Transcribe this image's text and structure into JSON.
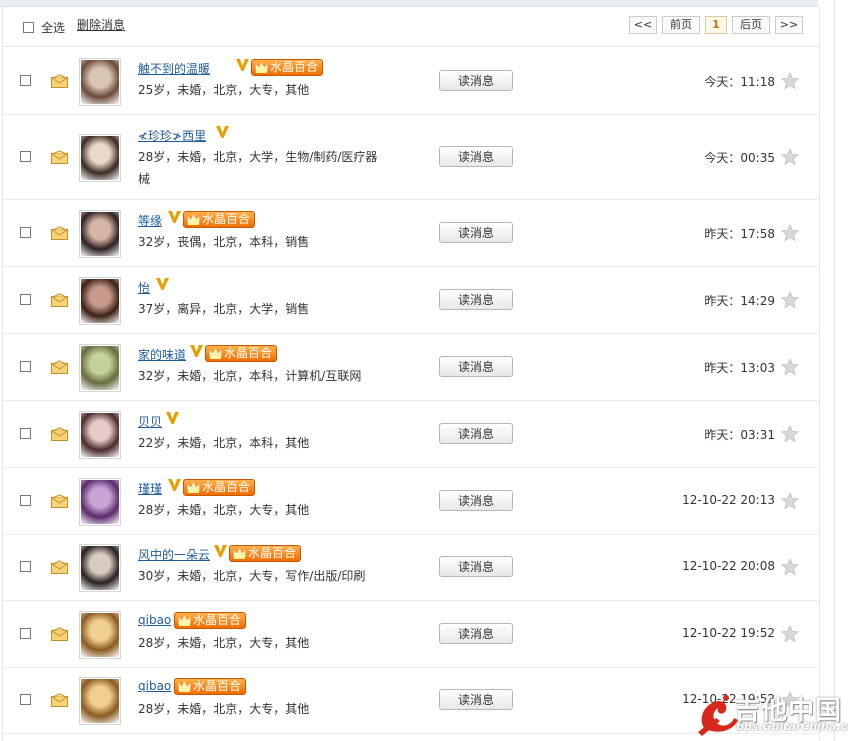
{
  "toolbar": {
    "select_all": "全选",
    "delete": "删除消息"
  },
  "pager": {
    "first": "<<",
    "prev": "前页",
    "current": "1",
    "next": "后页",
    "last": ">>"
  },
  "read_label": "读消息",
  "badge_text": "水晶百合",
  "colors": {
    "link": "#1f5c99",
    "badge_bg": "#ef6d00",
    "vip": "#e8a000",
    "current_page": "#d56a00"
  },
  "icons": {
    "envelope": "envelope-icon",
    "star": "star-icon",
    "vip": "vip-v-icon",
    "crown": "crown-icon"
  },
  "messages": [
    {
      "name": "触不到的温暖",
      "vip": true,
      "badge": true,
      "info": "25岁，未婚，北京，大专，其他",
      "time": "今天：11:18"
    },
    {
      "name": "≮珍珍≯西里",
      "vip": true,
      "badge": false,
      "info": "28岁，未婚，北京，大学，生物/制药/医疗器械",
      "time": "今天：00:35"
    },
    {
      "name": "等缘",
      "vip": true,
      "badge": true,
      "info": "32岁，丧偶，北京，本科，销售",
      "time": "昨天：17:58"
    },
    {
      "name": "怡",
      "vip": true,
      "badge": false,
      "info": "37岁，离异，北京，大学，销售",
      "time": "昨天：14:29"
    },
    {
      "name": "家的味道",
      "vip": true,
      "badge": true,
      "info": "32岁，未婚，北京，本科，计算机/互联网",
      "time": "昨天：13:03"
    },
    {
      "name": "贝贝",
      "vip": true,
      "badge": false,
      "info": "22岁，未婚，北京，本科，其他",
      "time": "昨天：03:31"
    },
    {
      "name": "瑾瑾",
      "vip": true,
      "badge": true,
      "info": "28岁，未婚，北京，大专，其他",
      "time": "12-10-22 20:13"
    },
    {
      "name": "风中的一朵云",
      "vip": true,
      "badge": true,
      "info": "30岁，未婚，北京，大专，写作/出版/印刷",
      "time": "12-10-22 20:08"
    },
    {
      "name": "qibao",
      "vip": false,
      "badge": true,
      "info": "28岁，未婚，北京，大专，其他",
      "time": "12-10-22 19:52"
    },
    {
      "name": "qibao",
      "vip": false,
      "badge": true,
      "info": "28岁，未婚，北京，大专，其他",
      "time": "12-10-22 19:52"
    }
  ],
  "watermark": {
    "title": "吉他中国",
    "site": "bbs.GuitarChina.com"
  }
}
